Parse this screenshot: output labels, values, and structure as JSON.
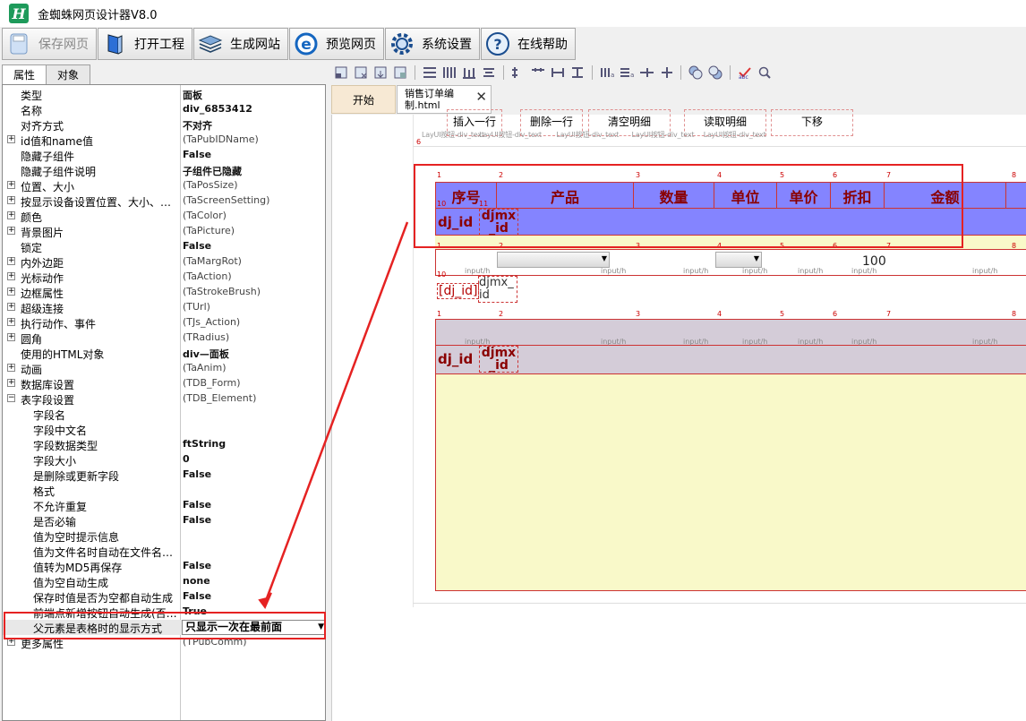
{
  "app": {
    "title": "金蜘蛛网页设计器V8.0",
    "logo_letter": "H"
  },
  "toolbar": [
    {
      "label": "保存网页",
      "icon": "save-icon",
      "disabled": true
    },
    {
      "label": "打开工程",
      "icon": "open-project-icon"
    },
    {
      "label": "生成网站",
      "icon": "layers-icon"
    },
    {
      "label": "预览网页",
      "icon": "ie-browser-icon"
    },
    {
      "label": "系统设置",
      "icon": "gear-icon"
    },
    {
      "label": "在线帮助",
      "icon": "help-icon"
    }
  ],
  "left_tabs": [
    "属性",
    "对象"
  ],
  "properties": [
    {
      "k": "类型",
      "v": "面板",
      "b": true,
      "indent": 0
    },
    {
      "k": "名称",
      "v": "div_6853412",
      "b": true,
      "indent": 0
    },
    {
      "k": "对齐方式",
      "v": "不对齐",
      "b": true,
      "indent": 0
    },
    {
      "k": "id值和name值",
      "v": "(TaPubIDName)",
      "exp": true,
      "indent": 0
    },
    {
      "k": "隐藏子组件",
      "v": "False",
      "b": true,
      "indent": 0
    },
    {
      "k": "隐藏子组件说明",
      "v": "子组件已隐藏",
      "b": true,
      "indent": 0
    },
    {
      "k": "位置、大小",
      "v": "(TaPosSize)",
      "exp": true,
      "indent": 0
    },
    {
      "k": "按显示设备设置位置、大小、…",
      "v": "(TaScreenSetting)",
      "exp": true,
      "indent": 0
    },
    {
      "k": "颜色",
      "v": "(TaColor)",
      "exp": true,
      "indent": 0
    },
    {
      "k": "背景图片",
      "v": "(TaPicture)",
      "exp": true,
      "indent": 0
    },
    {
      "k": "锁定",
      "v": "False",
      "b": true,
      "indent": 0
    },
    {
      "k": "内外边距",
      "v": "(TaMargRot)",
      "exp": true,
      "indent": 0
    },
    {
      "k": "光标动作",
      "v": "(TaAction)",
      "exp": true,
      "indent": 0
    },
    {
      "k": "边框属性",
      "v": "(TaStrokeBrush)",
      "exp": true,
      "indent": 0
    },
    {
      "k": "超级连接",
      "v": "(TUrl)",
      "exp": true,
      "indent": 0
    },
    {
      "k": "执行动作、事件",
      "v": "(TJs_Action)",
      "exp": true,
      "indent": 0
    },
    {
      "k": "圆角",
      "v": "(TRadius)",
      "exp": true,
      "indent": 0
    },
    {
      "k": "使用的HTML对象",
      "v": "div—面板",
      "b": true,
      "indent": 0
    },
    {
      "k": "动画",
      "v": "(TaAnim)",
      "exp": true,
      "indent": 0
    },
    {
      "k": "数据库设置",
      "v": "(TDB_Form)",
      "exp": true,
      "indent": 0
    },
    {
      "k": "表字段设置",
      "v": "(TDB_Element)",
      "exp": true,
      "open": true,
      "indent": 0
    },
    {
      "k": "字段名",
      "v": "",
      "indent": 1
    },
    {
      "k": "字段中文名",
      "v": "",
      "indent": 1
    },
    {
      "k": "字段数据类型",
      "v": "ftString",
      "b": true,
      "indent": 1
    },
    {
      "k": "字段大小",
      "v": "0",
      "b": true,
      "indent": 1
    },
    {
      "k": "是删除或更新字段",
      "v": "False",
      "b": true,
      "indent": 1
    },
    {
      "k": "格式",
      "v": "",
      "indent": 1
    },
    {
      "k": "不允许重复",
      "v": "False",
      "b": true,
      "indent": 1
    },
    {
      "k": "是否必输",
      "v": "False",
      "b": true,
      "indent": 1
    },
    {
      "k": "值为空时提示信息",
      "v": "",
      "indent": 1
    },
    {
      "k": "值为文件名时自动在文件名…",
      "v": "",
      "indent": 1
    },
    {
      "k": "值转为MD5再保存",
      "v": "False",
      "b": true,
      "indent": 1
    },
    {
      "k": "值为空自动生成",
      "v": "none",
      "b": true,
      "indent": 1
    },
    {
      "k": "保存时值是否为空都自动生成",
      "v": "False",
      "b": true,
      "indent": 1
    },
    {
      "k": "前端点新增按钮自动生成(否…",
      "v": "True",
      "b": true,
      "indent": 1
    },
    {
      "k": "父元素是表格时的显示方式",
      "v": "只显示一次在最前面",
      "b": true,
      "indent": 1,
      "dropdown": true
    },
    {
      "k": "更多属性",
      "v": "(TPubComm)",
      "exp": true,
      "indent": 0
    }
  ],
  "doc_tabs": {
    "start": "开始",
    "file": "销售订单编制.html"
  },
  "canvas": {
    "buttons": [
      "插入一行",
      "删除一行",
      "清空明细",
      "读取明细",
      "下移"
    ],
    "button_caption": "LayUI按钮-div_text",
    "headers": [
      "序号",
      "产品",
      "数量",
      "单位",
      "单价",
      "折扣",
      "金额"
    ],
    "hdr_fields": [
      "dj_id",
      "djmx_id"
    ],
    "row_fields": [
      "[dj_id]",
      "djmx_id"
    ],
    "input_caption": "input/h",
    "discount_value": "100",
    "col_numbers": [
      "1",
      "2",
      "3",
      "4",
      "5",
      "6",
      "7",
      "8"
    ],
    "row_small_nums": [
      "10",
      "11"
    ],
    "mark6": "6"
  }
}
